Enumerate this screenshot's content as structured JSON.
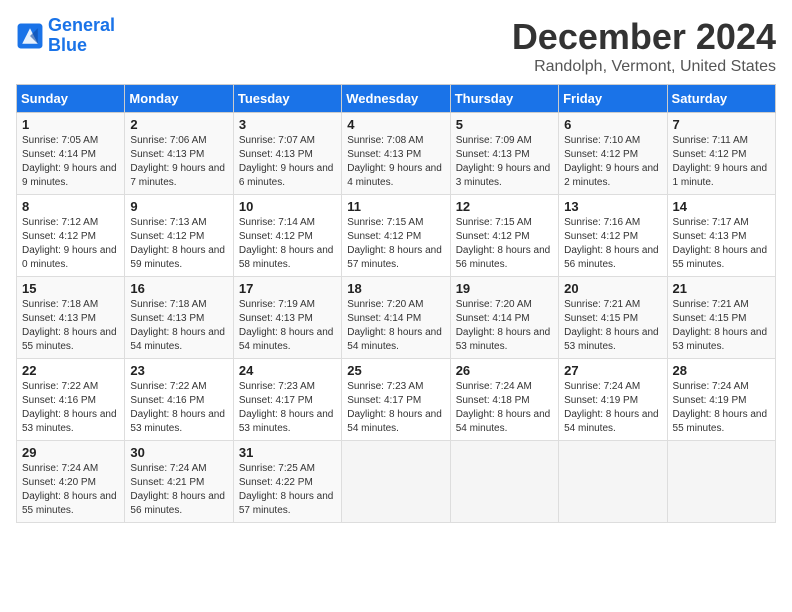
{
  "header": {
    "logo_line1": "General",
    "logo_line2": "Blue",
    "month": "December 2024",
    "location": "Randolph, Vermont, United States"
  },
  "weekdays": [
    "Sunday",
    "Monday",
    "Tuesday",
    "Wednesday",
    "Thursday",
    "Friday",
    "Saturday"
  ],
  "weeks": [
    [
      {
        "day": "1",
        "sunrise": "7:05 AM",
        "sunset": "4:14 PM",
        "daylight": "9 hours and 9 minutes."
      },
      {
        "day": "2",
        "sunrise": "7:06 AM",
        "sunset": "4:13 PM",
        "daylight": "9 hours and 7 minutes."
      },
      {
        "day": "3",
        "sunrise": "7:07 AM",
        "sunset": "4:13 PM",
        "daylight": "9 hours and 6 minutes."
      },
      {
        "day": "4",
        "sunrise": "7:08 AM",
        "sunset": "4:13 PM",
        "daylight": "9 hours and 4 minutes."
      },
      {
        "day": "5",
        "sunrise": "7:09 AM",
        "sunset": "4:13 PM",
        "daylight": "9 hours and 3 minutes."
      },
      {
        "day": "6",
        "sunrise": "7:10 AM",
        "sunset": "4:12 PM",
        "daylight": "9 hours and 2 minutes."
      },
      {
        "day": "7",
        "sunrise": "7:11 AM",
        "sunset": "4:12 PM",
        "daylight": "9 hours and 1 minute."
      }
    ],
    [
      {
        "day": "8",
        "sunrise": "7:12 AM",
        "sunset": "4:12 PM",
        "daylight": "9 hours and 0 minutes."
      },
      {
        "day": "9",
        "sunrise": "7:13 AM",
        "sunset": "4:12 PM",
        "daylight": "8 hours and 59 minutes."
      },
      {
        "day": "10",
        "sunrise": "7:14 AM",
        "sunset": "4:12 PM",
        "daylight": "8 hours and 58 minutes."
      },
      {
        "day": "11",
        "sunrise": "7:15 AM",
        "sunset": "4:12 PM",
        "daylight": "8 hours and 57 minutes."
      },
      {
        "day": "12",
        "sunrise": "7:15 AM",
        "sunset": "4:12 PM",
        "daylight": "8 hours and 56 minutes."
      },
      {
        "day": "13",
        "sunrise": "7:16 AM",
        "sunset": "4:12 PM",
        "daylight": "8 hours and 56 minutes."
      },
      {
        "day": "14",
        "sunrise": "7:17 AM",
        "sunset": "4:13 PM",
        "daylight": "8 hours and 55 minutes."
      }
    ],
    [
      {
        "day": "15",
        "sunrise": "7:18 AM",
        "sunset": "4:13 PM",
        "daylight": "8 hours and 55 minutes."
      },
      {
        "day": "16",
        "sunrise": "7:18 AM",
        "sunset": "4:13 PM",
        "daylight": "8 hours and 54 minutes."
      },
      {
        "day": "17",
        "sunrise": "7:19 AM",
        "sunset": "4:13 PM",
        "daylight": "8 hours and 54 minutes."
      },
      {
        "day": "18",
        "sunrise": "7:20 AM",
        "sunset": "4:14 PM",
        "daylight": "8 hours and 54 minutes."
      },
      {
        "day": "19",
        "sunrise": "7:20 AM",
        "sunset": "4:14 PM",
        "daylight": "8 hours and 53 minutes."
      },
      {
        "day": "20",
        "sunrise": "7:21 AM",
        "sunset": "4:15 PM",
        "daylight": "8 hours and 53 minutes."
      },
      {
        "day": "21",
        "sunrise": "7:21 AM",
        "sunset": "4:15 PM",
        "daylight": "8 hours and 53 minutes."
      }
    ],
    [
      {
        "day": "22",
        "sunrise": "7:22 AM",
        "sunset": "4:16 PM",
        "daylight": "8 hours and 53 minutes."
      },
      {
        "day": "23",
        "sunrise": "7:22 AM",
        "sunset": "4:16 PM",
        "daylight": "8 hours and 53 minutes."
      },
      {
        "day": "24",
        "sunrise": "7:23 AM",
        "sunset": "4:17 PM",
        "daylight": "8 hours and 53 minutes."
      },
      {
        "day": "25",
        "sunrise": "7:23 AM",
        "sunset": "4:17 PM",
        "daylight": "8 hours and 54 minutes."
      },
      {
        "day": "26",
        "sunrise": "7:24 AM",
        "sunset": "4:18 PM",
        "daylight": "8 hours and 54 minutes."
      },
      {
        "day": "27",
        "sunrise": "7:24 AM",
        "sunset": "4:19 PM",
        "daylight": "8 hours and 54 minutes."
      },
      {
        "day": "28",
        "sunrise": "7:24 AM",
        "sunset": "4:19 PM",
        "daylight": "8 hours and 55 minutes."
      }
    ],
    [
      {
        "day": "29",
        "sunrise": "7:24 AM",
        "sunset": "4:20 PM",
        "daylight": "8 hours and 55 minutes."
      },
      {
        "day": "30",
        "sunrise": "7:24 AM",
        "sunset": "4:21 PM",
        "daylight": "8 hours and 56 minutes."
      },
      {
        "day": "31",
        "sunrise": "7:25 AM",
        "sunset": "4:22 PM",
        "daylight": "8 hours and 57 minutes."
      },
      null,
      null,
      null,
      null
    ]
  ]
}
